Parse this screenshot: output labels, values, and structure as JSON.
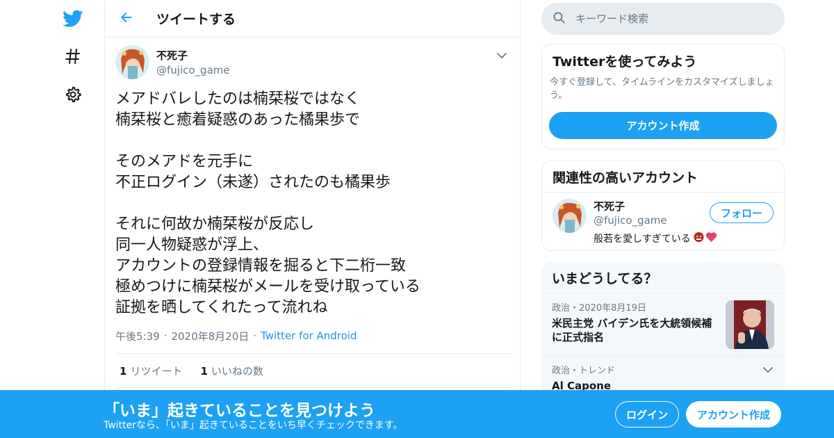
{
  "colors": {
    "accent": "#1da1f2",
    "text_primary": "#14171a",
    "text_secondary": "#657786",
    "border": "#e6ecf0",
    "banner_bg": "#1da1f2"
  },
  "nav": {
    "icons": [
      "twitter-bird-icon",
      "hashtag-icon",
      "gear-icon"
    ]
  },
  "header": {
    "title": "ツイートする"
  },
  "tweet": {
    "author_name": "不死子",
    "author_handle": "@fujico_game",
    "text": "メアドバレしたのは楠栞桜ではなく\n楠栞桜と癒着疑惑のあった橘果歩で\n\nそのメアドを元手に\n不正ログイン（未遂）されたのも橘果歩\n\nそれに何故か楠栞桜が反応し\n同一人物疑惑が浮上、\nアカウントの登録情報を掘ると下二桁一致\n極めつけに楠栞桜がメールを受け取っている\n証拠を晒してくれたって流れね",
    "time": "午後5:39",
    "date": "2020年8月20日",
    "dot": "·",
    "source": "Twitter for Android",
    "retweet_count": "1",
    "retweet_label": "リツイート",
    "like_count": "1",
    "like_label": "いいねの数"
  },
  "sidebar": {
    "search_placeholder": "キーワード検索",
    "try_card": {
      "title": "Twitterを使ってみよう",
      "description": "今すぐ登録して、タイムラインをカスタマイズしましょう。",
      "button": "アカウント作成"
    },
    "related": {
      "title": "関連性の高いアカウント",
      "name": "不死子",
      "handle": "@fujico_game",
      "bio": "般若を愛しすぎている",
      "follow_button": "フォロー"
    },
    "trends": {
      "title": "いまどうしてる？",
      "items": [
        {
          "meta": "政治・2020年8月19日",
          "title": "米民主党 バイデン氏を大統領候補に正式指名"
        },
        {
          "meta": "政治・トレンド",
          "title": "Al Capone"
        }
      ]
    }
  },
  "banner": {
    "title": "「いま」起きていることを見つけよう",
    "subtitle": "Twitterなら、「いま」起きていることをいち早くチェックできます。",
    "login_button": "ログイン",
    "signup_button": "アカウント作成"
  }
}
